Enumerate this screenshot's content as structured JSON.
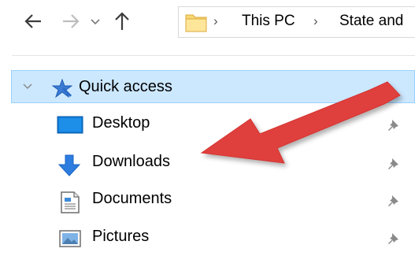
{
  "toolbar": {
    "back_icon": "arrow-left-icon",
    "forward_icon": "arrow-right-icon",
    "recent_icon": "chevron-down-icon",
    "up_icon": "arrow-up-icon"
  },
  "address_bar": {
    "folder_icon": "folder-icon",
    "crumbs": [
      "This PC",
      "State and"
    ]
  },
  "sidebar": {
    "quick_access": {
      "label": "Quick access",
      "expanded": true,
      "selected": true
    },
    "items": [
      {
        "label": "Desktop",
        "icon": "desktop-icon",
        "pinned": true
      },
      {
        "label": "Downloads",
        "icon": "download-arrow-icon",
        "pinned": true
      },
      {
        "label": "Documents",
        "icon": "document-icon",
        "pinned": true
      },
      {
        "label": "Pictures",
        "icon": "pictures-icon",
        "pinned": true
      }
    ]
  },
  "annotation": {
    "shape": "arrow",
    "color": "#e0403d",
    "points_to": "Downloads"
  }
}
